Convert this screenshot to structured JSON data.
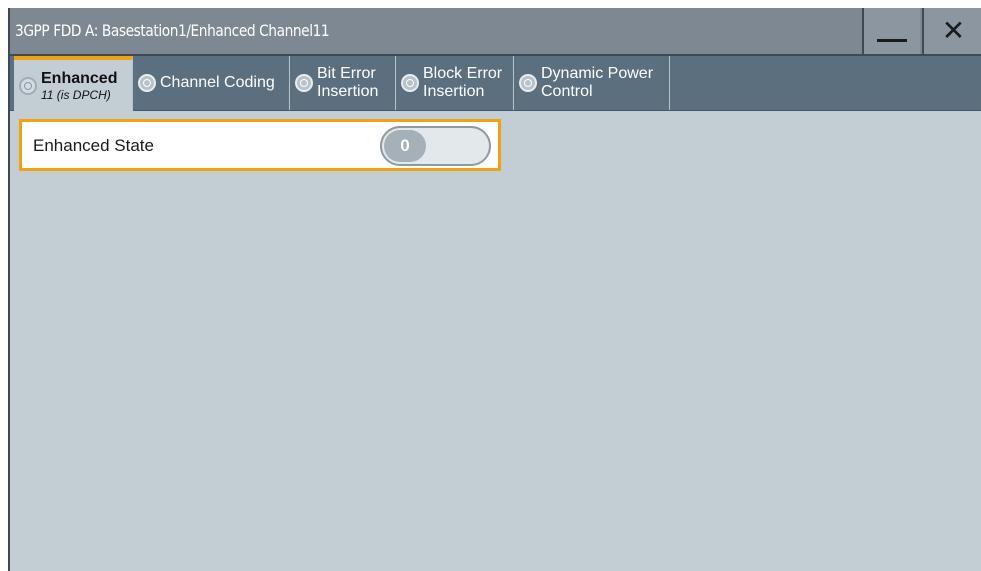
{
  "window": {
    "title": "3GPP FDD A: Basestation1/Enhanced Channel11",
    "minimize_icon": "minimize-icon",
    "close_icon": "close-icon",
    "close_glyph": "✕"
  },
  "tabs": [
    {
      "label": "Enhanced",
      "sublabel": "11 (is DPCH)",
      "active": true
    },
    {
      "label": "Channel Coding",
      "active": false
    },
    {
      "label": "Bit Error",
      "label2": "Insertion",
      "active": false
    },
    {
      "label": "Block Error",
      "label2": "Insertion",
      "active": false
    },
    {
      "label": "Dynamic Power",
      "label2": "Control",
      "active": false
    }
  ],
  "enhanced_state": {
    "label": "Enhanced State",
    "value": "0"
  },
  "colors": {
    "accent": "#f0a215",
    "titlebar": "#7d8893",
    "tabbar": "#5b6f7f",
    "background": "#c3ced4"
  }
}
